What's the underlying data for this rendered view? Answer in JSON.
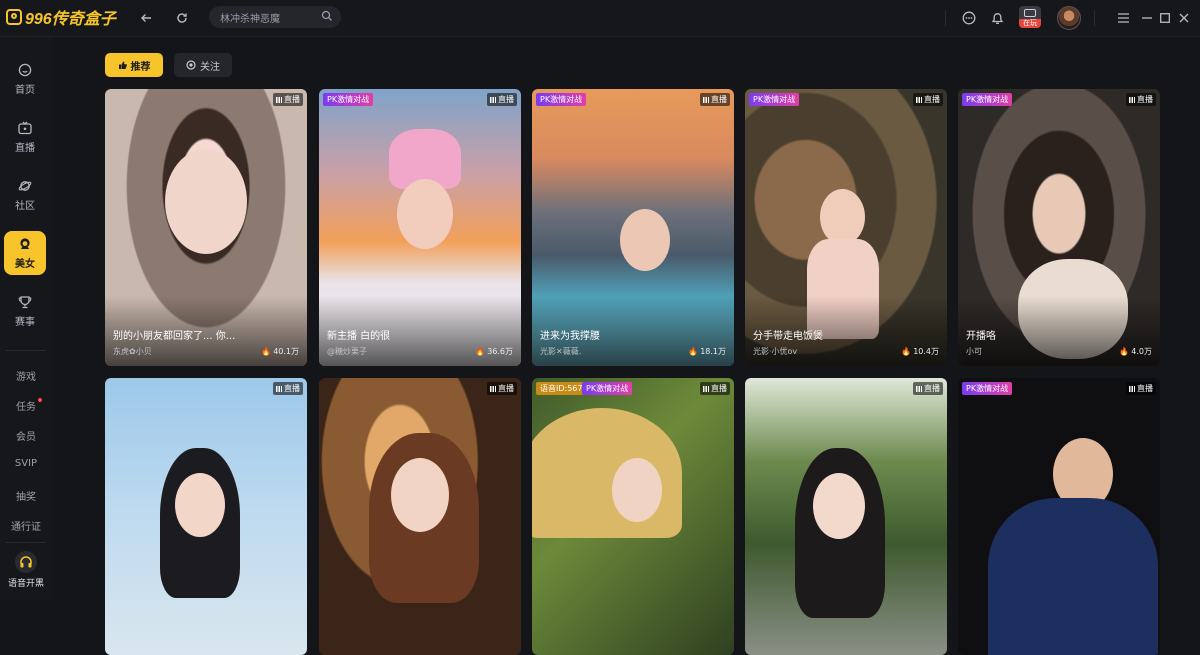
{
  "app": {
    "logo_text": "996传奇盒子"
  },
  "search": {
    "placeholder": "林冲杀神恶魔"
  },
  "topbar": {
    "live_tag": "在玩"
  },
  "sidebar": {
    "items": [
      {
        "label": "首页",
        "icon": "home-icon"
      },
      {
        "label": "直播",
        "icon": "tv-icon"
      },
      {
        "label": "社区",
        "icon": "planet-icon"
      },
      {
        "label": "美女",
        "icon": "girl-icon",
        "active": true
      },
      {
        "label": "赛事",
        "icon": "trophy-icon"
      }
    ],
    "links": [
      "游戏",
      "任务",
      "会员",
      "SVIP",
      "抽奖",
      "通行证"
    ],
    "voice_label": "语音开黑"
  },
  "tabs": {
    "recommend": "推荐",
    "follow": "关注"
  },
  "live_badge": "直播",
  "pk_badge": "PK激情对战",
  "cards": [
    {
      "title": "别的小朋友都回家了... 你...",
      "anchor": "东虎✿小贝",
      "heat": "40.1万",
      "pk": false,
      "voice": ""
    },
    {
      "title": "新主播 白的很",
      "anchor": "@糖炒栗子",
      "heat": "36.6万",
      "pk": true,
      "voice": ""
    },
    {
      "title": "进来为我撑腰",
      "anchor": "光影✕薇薇.",
      "heat": "18.1万",
      "pk": true,
      "voice": ""
    },
    {
      "title": "分手带走电饭煲",
      "anchor": "光影·小优ov",
      "heat": "10.4万",
      "pk": true,
      "voice": ""
    },
    {
      "title": "开播咯",
      "anchor": "小可",
      "heat": "4.0万",
      "pk": true,
      "voice": ""
    },
    {
      "title": "",
      "anchor": "",
      "heat": "",
      "pk": false,
      "voice": ""
    },
    {
      "title": "",
      "anchor": "",
      "heat": "",
      "pk": false,
      "voice": ""
    },
    {
      "title": "",
      "anchor": "",
      "heat": "",
      "pk": true,
      "voice": "语音ID:567"
    },
    {
      "title": "",
      "anchor": "",
      "heat": "",
      "pk": false,
      "voice": ""
    },
    {
      "title": "",
      "anchor": "",
      "heat": "",
      "pk": true,
      "voice": ""
    }
  ],
  "colors": {
    "accent": "#f7c52b",
    "background": "#141519",
    "pk_gradient_start": "#7a3cf0",
    "pk_gradient_end": "#e03fa6"
  }
}
